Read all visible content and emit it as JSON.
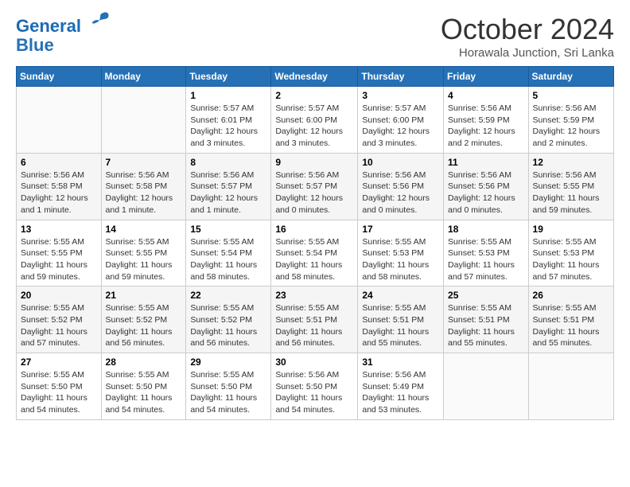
{
  "logo": {
    "line1": "General",
    "line2": "Blue"
  },
  "title": "October 2024",
  "subtitle": "Horawala Junction, Sri Lanka",
  "days_header": [
    "Sunday",
    "Monday",
    "Tuesday",
    "Wednesday",
    "Thursday",
    "Friday",
    "Saturday"
  ],
  "weeks": [
    [
      {
        "day": "",
        "info": ""
      },
      {
        "day": "",
        "info": ""
      },
      {
        "day": "1",
        "info": "Sunrise: 5:57 AM\nSunset: 6:01 PM\nDaylight: 12 hours\nand 3 minutes."
      },
      {
        "day": "2",
        "info": "Sunrise: 5:57 AM\nSunset: 6:00 PM\nDaylight: 12 hours\nand 3 minutes."
      },
      {
        "day": "3",
        "info": "Sunrise: 5:57 AM\nSunset: 6:00 PM\nDaylight: 12 hours\nand 3 minutes."
      },
      {
        "day": "4",
        "info": "Sunrise: 5:56 AM\nSunset: 5:59 PM\nDaylight: 12 hours\nand 2 minutes."
      },
      {
        "day": "5",
        "info": "Sunrise: 5:56 AM\nSunset: 5:59 PM\nDaylight: 12 hours\nand 2 minutes."
      }
    ],
    [
      {
        "day": "6",
        "info": "Sunrise: 5:56 AM\nSunset: 5:58 PM\nDaylight: 12 hours\nand 1 minute."
      },
      {
        "day": "7",
        "info": "Sunrise: 5:56 AM\nSunset: 5:58 PM\nDaylight: 12 hours\nand 1 minute."
      },
      {
        "day": "8",
        "info": "Sunrise: 5:56 AM\nSunset: 5:57 PM\nDaylight: 12 hours\nand 1 minute."
      },
      {
        "day": "9",
        "info": "Sunrise: 5:56 AM\nSunset: 5:57 PM\nDaylight: 12 hours\nand 0 minutes."
      },
      {
        "day": "10",
        "info": "Sunrise: 5:56 AM\nSunset: 5:56 PM\nDaylight: 12 hours\nand 0 minutes."
      },
      {
        "day": "11",
        "info": "Sunrise: 5:56 AM\nSunset: 5:56 PM\nDaylight: 12 hours\nand 0 minutes."
      },
      {
        "day": "12",
        "info": "Sunrise: 5:56 AM\nSunset: 5:55 PM\nDaylight: 11 hours\nand 59 minutes."
      }
    ],
    [
      {
        "day": "13",
        "info": "Sunrise: 5:55 AM\nSunset: 5:55 PM\nDaylight: 11 hours\nand 59 minutes."
      },
      {
        "day": "14",
        "info": "Sunrise: 5:55 AM\nSunset: 5:55 PM\nDaylight: 11 hours\nand 59 minutes."
      },
      {
        "day": "15",
        "info": "Sunrise: 5:55 AM\nSunset: 5:54 PM\nDaylight: 11 hours\nand 58 minutes."
      },
      {
        "day": "16",
        "info": "Sunrise: 5:55 AM\nSunset: 5:54 PM\nDaylight: 11 hours\nand 58 minutes."
      },
      {
        "day": "17",
        "info": "Sunrise: 5:55 AM\nSunset: 5:53 PM\nDaylight: 11 hours\nand 58 minutes."
      },
      {
        "day": "18",
        "info": "Sunrise: 5:55 AM\nSunset: 5:53 PM\nDaylight: 11 hours\nand 57 minutes."
      },
      {
        "day": "19",
        "info": "Sunrise: 5:55 AM\nSunset: 5:53 PM\nDaylight: 11 hours\nand 57 minutes."
      }
    ],
    [
      {
        "day": "20",
        "info": "Sunrise: 5:55 AM\nSunset: 5:52 PM\nDaylight: 11 hours\nand 57 minutes."
      },
      {
        "day": "21",
        "info": "Sunrise: 5:55 AM\nSunset: 5:52 PM\nDaylight: 11 hours\nand 56 minutes."
      },
      {
        "day": "22",
        "info": "Sunrise: 5:55 AM\nSunset: 5:52 PM\nDaylight: 11 hours\nand 56 minutes."
      },
      {
        "day": "23",
        "info": "Sunrise: 5:55 AM\nSunset: 5:51 PM\nDaylight: 11 hours\nand 56 minutes."
      },
      {
        "day": "24",
        "info": "Sunrise: 5:55 AM\nSunset: 5:51 PM\nDaylight: 11 hours\nand 55 minutes."
      },
      {
        "day": "25",
        "info": "Sunrise: 5:55 AM\nSunset: 5:51 PM\nDaylight: 11 hours\nand 55 minutes."
      },
      {
        "day": "26",
        "info": "Sunrise: 5:55 AM\nSunset: 5:51 PM\nDaylight: 11 hours\nand 55 minutes."
      }
    ],
    [
      {
        "day": "27",
        "info": "Sunrise: 5:55 AM\nSunset: 5:50 PM\nDaylight: 11 hours\nand 54 minutes."
      },
      {
        "day": "28",
        "info": "Sunrise: 5:55 AM\nSunset: 5:50 PM\nDaylight: 11 hours\nand 54 minutes."
      },
      {
        "day": "29",
        "info": "Sunrise: 5:55 AM\nSunset: 5:50 PM\nDaylight: 11 hours\nand 54 minutes."
      },
      {
        "day": "30",
        "info": "Sunrise: 5:56 AM\nSunset: 5:50 PM\nDaylight: 11 hours\nand 54 minutes."
      },
      {
        "day": "31",
        "info": "Sunrise: 5:56 AM\nSunset: 5:49 PM\nDaylight: 11 hours\nand 53 minutes."
      },
      {
        "day": "",
        "info": ""
      },
      {
        "day": "",
        "info": ""
      }
    ]
  ]
}
